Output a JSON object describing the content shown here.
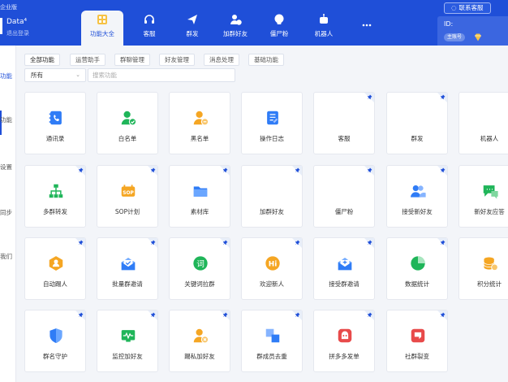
{
  "header": {
    "brand": "企业版",
    "account_name": "Data⁴",
    "account_logout": "退出登录",
    "customer_service_button": "联系客服",
    "id_label": "ID:",
    "id_badge": "主账号",
    "nav_tabs": [
      {
        "label": "功能大全",
        "icon": "grid-icon",
        "active": true
      },
      {
        "label": "客服",
        "icon": "headset-icon"
      },
      {
        "label": "群发",
        "icon": "paper-plane-icon"
      },
      {
        "label": "加群好友",
        "icon": "add-user-icon"
      },
      {
        "label": "僵尸粉",
        "icon": "skull-icon"
      },
      {
        "label": "机器人",
        "icon": "robot-icon"
      },
      {
        "label": "···",
        "icon": "more-icon"
      }
    ]
  },
  "sidebar": {
    "items": [
      {
        "label": "功能",
        "active": true
      },
      {
        "label": "功能"
      },
      {
        "label": "设置"
      },
      {
        "label": "同步"
      },
      {
        "label": "我们"
      }
    ]
  },
  "filters": {
    "tabs": [
      "全部功能",
      "运营助手",
      "群聊管理",
      "好友管理",
      "消息处理",
      "基础功能"
    ],
    "active": "全部功能",
    "select_value": "所有",
    "search_placeholder": "搜索功能"
  },
  "features": [
    {
      "label": "通讯录",
      "icon": "contacts-book-icon",
      "pinned": false
    },
    {
      "label": "白名单",
      "icon": "whitelist-user-icon",
      "pinned": false
    },
    {
      "label": "黑名单",
      "icon": "blacklist-user-icon",
      "pinned": false
    },
    {
      "label": "操作日志",
      "icon": "operation-log-icon",
      "pinned": false
    },
    {
      "label": "客服",
      "icon": "headset-icon",
      "pinned": true
    },
    {
      "label": "群发",
      "icon": "paper-plane-icon",
      "pinned": true
    },
    {
      "label": "机器人",
      "icon": "robot-icon",
      "pinned": true
    },
    {
      "label": "多群转发",
      "icon": "network-icon",
      "pinned": true
    },
    {
      "label": "SOP计划",
      "icon": "sop-icon",
      "pinned": true
    },
    {
      "label": "素材库",
      "icon": "folder-icon",
      "pinned": true
    },
    {
      "label": "加群好友",
      "icon": "add-user-icon",
      "pinned": true
    },
    {
      "label": "僵尸粉",
      "icon": "skull-icon",
      "pinned": true
    },
    {
      "label": "接受新好友",
      "icon": "users-icon",
      "pinned": true
    },
    {
      "label": "新好友应答",
      "icon": "chat-reply-icon",
      "pinned": true
    },
    {
      "label": "自动踢人",
      "icon": "kick-user-icon",
      "pinned": true
    },
    {
      "label": "批量群邀请",
      "icon": "mail-invite-icon",
      "pinned": true
    },
    {
      "label": "关键词拉群",
      "icon": "keyword-icon",
      "pinned": true
    },
    {
      "label": "欢迎新人",
      "icon": "welcome-hi-icon",
      "pinned": true
    },
    {
      "label": "接受群邀请",
      "icon": "mail-accept-icon",
      "pinned": true
    },
    {
      "label": "数据统计",
      "icon": "pie-chart-icon",
      "pinned": true
    },
    {
      "label": "积分统计",
      "icon": "coins-icon",
      "pinned": true
    },
    {
      "label": "群名守护",
      "icon": "shield-icon",
      "pinned": true
    },
    {
      "label": "监控加好友",
      "icon": "monitor-icon",
      "pinned": true
    },
    {
      "label": "踢私加好友",
      "icon": "remove-user-icon",
      "pinned": true
    },
    {
      "label": "群成员去重",
      "icon": "dedupe-icon",
      "pinned": true
    },
    {
      "label": "拼多多发单",
      "icon": "pinduoduo-icon",
      "pinned": true
    },
    {
      "label": "社群裂变",
      "icon": "fission-icon",
      "pinned": true
    }
  ],
  "colors": {
    "header_blue": "#1f4fd8",
    "icon_blue": "#2f7cf6",
    "icon_green": "#1fb559",
    "icon_orange": "#f5a623",
    "icon_red": "#e84a4a"
  }
}
